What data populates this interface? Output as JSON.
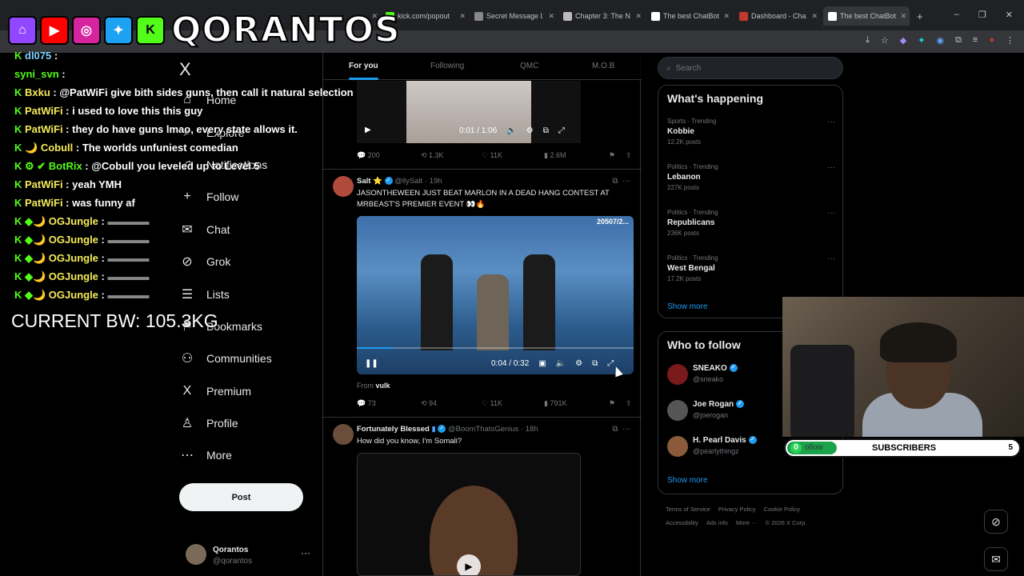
{
  "browser": {
    "tabs": [
      {
        "label": "",
        "color": "#5865f2"
      },
      {
        "label": "kick.com/popout",
        "color": "#53fc18"
      },
      {
        "label": "Secret Message L",
        "color": "#888888"
      },
      {
        "label": "Chapter 3: The N",
        "color": "#bbbbbb"
      },
      {
        "label": "The best ChatBot",
        "color": "#ffffff"
      },
      {
        "label": "Dashboard - Cha",
        "color": "#c0392b"
      },
      {
        "label": "The best ChatBot",
        "color": "#ffffff"
      }
    ],
    "new_tab": "+",
    "window_controls": [
      "–",
      "❐",
      "✕"
    ]
  },
  "overlay": {
    "brand": "QORANTOS",
    "logos": [
      {
        "name": "twitch",
        "glyph": "⌂",
        "color": "#9146ff"
      },
      {
        "name": "youtube",
        "glyph": "▶",
        "color": "#ff0000"
      },
      {
        "name": "instagram",
        "glyph": "◎",
        "color": "#d6249f"
      },
      {
        "name": "twitter",
        "glyph": "✦",
        "color": "#1da1f2"
      },
      {
        "name": "kick",
        "glyph": "K",
        "color": "#53fc18"
      }
    ],
    "chat": [
      {
        "user": "dl075",
        "msg": ""
      },
      {
        "user": "syni_svn",
        "msg": ""
      },
      {
        "user": "Bxku",
        "msg": "@PatWiFi give bith sides guns, then call it natural selection"
      },
      {
        "user": "PatWiFi",
        "msg": "i used to love this      this guy"
      },
      {
        "user": "PatWiFi",
        "msg": "they do have guns lmao, every state allows it."
      },
      {
        "user": "Cobull",
        "msg": "The worlds unfuniest comedian"
      },
      {
        "user": "BotRix",
        "msg": "@Cobull you leveled up to Level 5"
      },
      {
        "user": "PatWiFi",
        "msg": "yeah YMH"
      },
      {
        "user": "PatWiFi",
        "msg": "was funny af"
      },
      {
        "user": "OGJungle",
        "msg": ""
      },
      {
        "user": "OGJungle",
        "msg": ""
      },
      {
        "user": "OGJungle",
        "msg": ""
      },
      {
        "user": "OGJungle",
        "msg": ""
      },
      {
        "user": "OGJungle",
        "msg": ""
      }
    ],
    "body_weight": "CURRENT BW: 105.3KG",
    "subscribers": {
      "label": "SUBSCRIBERS",
      "count": "0",
      "goal": "5",
      "follow": "ollow"
    }
  },
  "nav": {
    "logo": "X",
    "items": [
      {
        "label": "Home",
        "icon": "⌂"
      },
      {
        "label": "Explore",
        "icon": "⌕"
      },
      {
        "label": "Notifications",
        "icon": "♫"
      },
      {
        "label": "Follow",
        "icon": "+"
      },
      {
        "label": "Chat",
        "icon": "✉"
      },
      {
        "label": "Grok",
        "icon": "⊘"
      },
      {
        "label": "Lists",
        "icon": "☰"
      },
      {
        "label": "Bookmarks",
        "icon": "⚑"
      },
      {
        "label": "Communities",
        "icon": "⚇"
      },
      {
        "label": "Premium",
        "icon": "X"
      },
      {
        "label": "Profile",
        "icon": "♙"
      },
      {
        "label": "More",
        "icon": "⋯"
      }
    ],
    "post": "Post",
    "account": {
      "name": "Qorantos",
      "handle": "@qorantos"
    }
  },
  "feed": {
    "tabs": [
      "For you",
      "Following",
      "QMC",
      "M.O.B"
    ],
    "tweets": [
      {
        "video": {
          "time": "0:01 / 1:06"
        },
        "stats": {
          "replies": "200",
          "reposts": "1.3K",
          "likes": "11K",
          "views": "2.6M"
        }
      },
      {
        "name": "Salt",
        "handle": "@llySalt",
        "time": "19h",
        "text": "JASONTHEWEEN JUST BEAT MARLON IN A DEAD HANG CONTEST AT MRBEAST'S PREMIER EVENT 👀🔥",
        "video": {
          "time": "0:04 / 0:32",
          "counter": "20507/2...",
          "progress": 0.13
        },
        "from": "From",
        "from_user": "vulk",
        "stats": {
          "replies": "73",
          "reposts": "94",
          "likes": "11K",
          "views": "791K"
        }
      },
      {
        "name": "Fortunately Blessed",
        "handle": "@BoomThatsGenius",
        "time": "18h",
        "text": "How did you know, I'm Somali?"
      }
    ]
  },
  "sidebar": {
    "search_placeholder": "Search",
    "happening_title": "What's happening",
    "trends": [
      {
        "context": "Sports · Trending",
        "topic": "Kobbie",
        "posts": "12.2K posts"
      },
      {
        "context": "Politics · Trending",
        "topic": "Lebanon",
        "posts": "227K posts"
      },
      {
        "context": "Politics · Trending",
        "topic": "Republicans",
        "posts": "236K posts"
      },
      {
        "context": "Politics · Trending",
        "topic": "West Bengal",
        "posts": "17.2K posts"
      }
    ],
    "show_more": "Show more",
    "wtf_title": "Who to follow",
    "who_to_follow": [
      {
        "name": "SNEAKO",
        "handle": "@sneako",
        "color": "#7a1a1a"
      },
      {
        "name": "Joe Rogan",
        "handle": "@joerogan",
        "color": "#555555"
      },
      {
        "name": "H. Pearl Davis",
        "handle": "@pearlythingz",
        "color": "#8a5a3a"
      }
    ],
    "footer": [
      "Terms of Service",
      "Privacy Policy",
      "Cookie Policy",
      "Accessibility",
      "Ads info",
      "More ···",
      "© 2026 X Corp."
    ]
  }
}
